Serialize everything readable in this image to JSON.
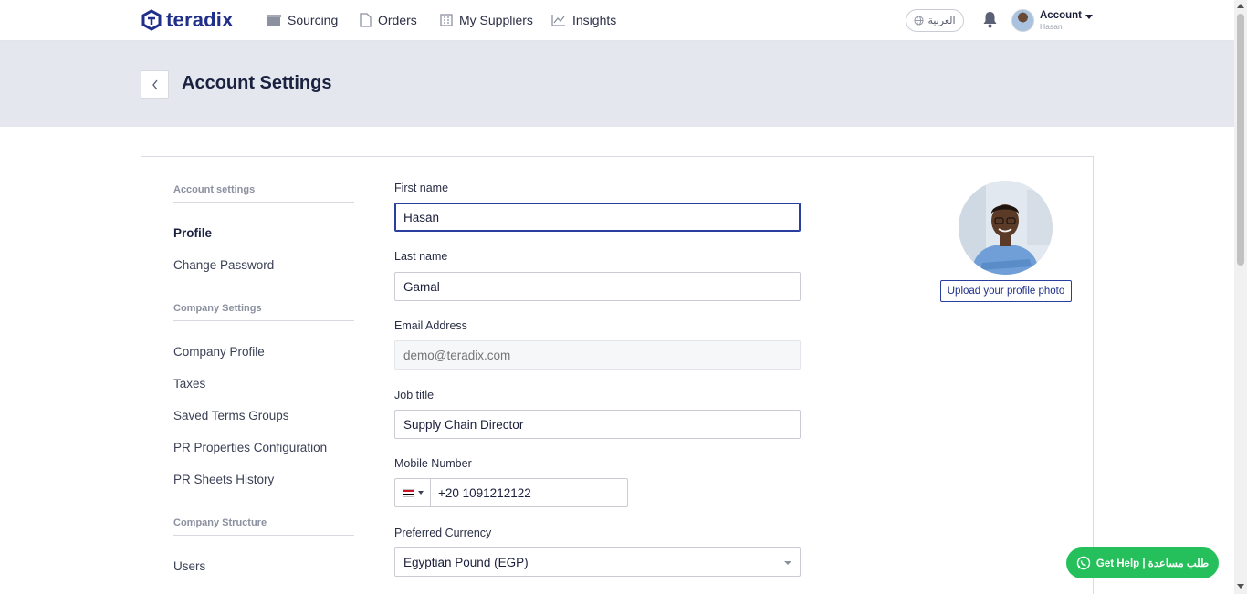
{
  "nav": {
    "logo": "teradix",
    "items": [
      {
        "label": "Sourcing",
        "icon": "box-icon"
      },
      {
        "label": "Orders",
        "icon": "document-icon"
      },
      {
        "label": "My Suppliers",
        "icon": "building-icon"
      },
      {
        "label": "Insights",
        "icon": "chart-icon"
      }
    ],
    "language": "العربية",
    "account_label": "Account",
    "account_user": "Hasan"
  },
  "page": {
    "title": "Account Settings"
  },
  "sidebar": {
    "sections": [
      {
        "heading": "Account settings",
        "items": [
          "Profile",
          "Change Password"
        ]
      },
      {
        "heading": "Company Settings",
        "items": [
          "Company Profile",
          "Taxes",
          "Saved Terms Groups",
          "PR Properties Configuration",
          "PR Sheets History"
        ]
      },
      {
        "heading": "Company Structure",
        "items": [
          "Users"
        ]
      }
    ],
    "active_item": "Profile"
  },
  "form": {
    "first_name_label": "First name",
    "first_name_value": "Hasan",
    "last_name_label": "Last name",
    "last_name_value": "Gamal",
    "email_label": "Email Address",
    "email_placeholder": "demo@teradix.com",
    "job_title_label": "Job title",
    "job_title_value": "Supply Chain Director",
    "mobile_label": "Mobile Number",
    "mobile_value": "+20 1091212122",
    "mobile_country": "Egypt",
    "currency_label": "Preferred Currency",
    "currency_value": "Egyptian Pound (EGP)"
  },
  "profile": {
    "upload_label": "Upload your profile photo"
  },
  "help": {
    "label": "Get Help | طلب مساعدة"
  },
  "colors": {
    "brand": "#1f2f8a",
    "header_band": "#e4e7ee",
    "help_green": "#25c05b"
  }
}
